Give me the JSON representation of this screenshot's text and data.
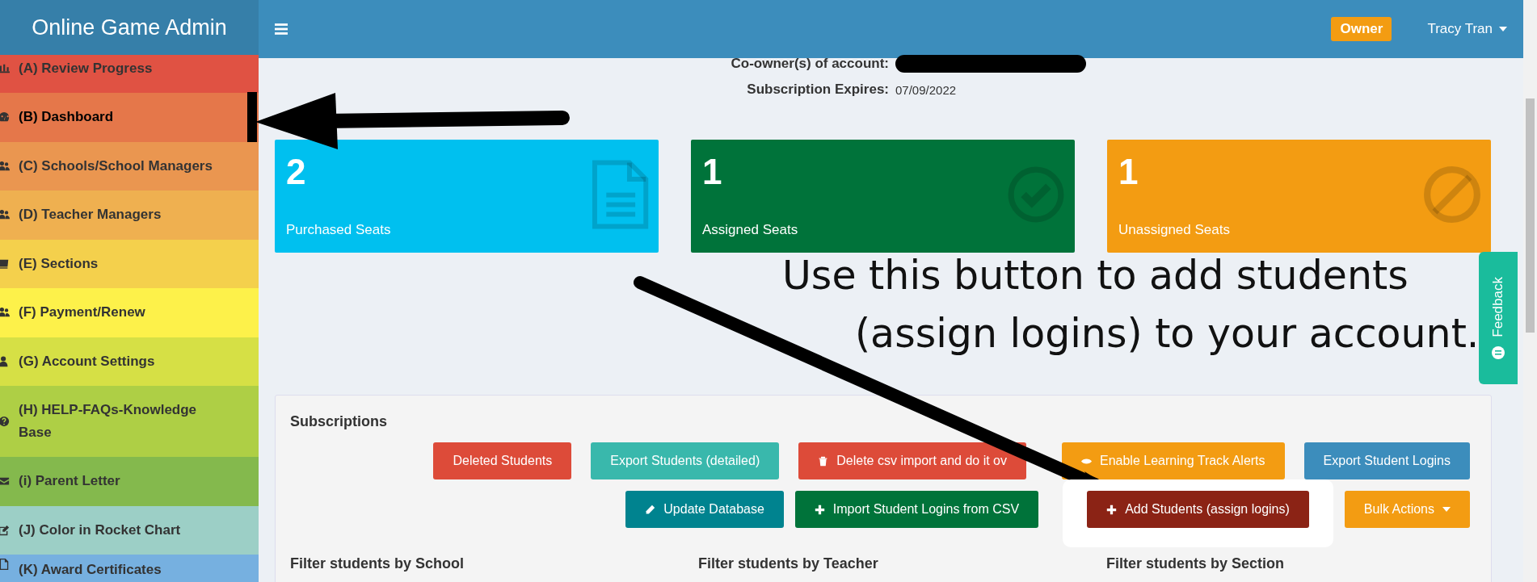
{
  "sidebar": {
    "title": "Online Game Admin",
    "items": [
      {
        "label": "(A) Review Progress",
        "selected": false,
        "color": "#e05243"
      },
      {
        "label": "(B) Dashboard",
        "selected": true,
        "color": "#e5774a"
      },
      {
        "label": "(C) Schools/School Managers",
        "selected": false,
        "color": "#ea9650"
      },
      {
        "label": "(D) Teacher Managers",
        "selected": false,
        "color": "#efb050"
      },
      {
        "label": "(E) Sections",
        "selected": false,
        "color": "#f4d04c"
      },
      {
        "label": "(F) Payment/Renew",
        "selected": false,
        "color": "#fdf14a"
      },
      {
        "label": "(G) Account Settings",
        "selected": false,
        "color": "#d6e045"
      },
      {
        "label": "(H) HELP-FAQs-Knowledge Base",
        "selected": false,
        "color": "#aecf45"
      },
      {
        "label": "(i) Parent Letter",
        "selected": false,
        "color": "#84b94d"
      },
      {
        "label": "(J) Color in Rocket Chart",
        "selected": false,
        "color": "#9ccfc6"
      },
      {
        "label": "(K) Award Certificates",
        "selected": false,
        "color": "#76b0e0"
      }
    ]
  },
  "navbar": {
    "role_badge": "Owner",
    "user": "Tracy Tran"
  },
  "account": [
    {
      "label": "Co-owner(s) of account:",
      "kind": "redacted"
    },
    {
      "label": "Subscription Expires:",
      "value": "07/09/2022",
      "kind": "text"
    }
  ],
  "stats": [
    {
      "count": "2",
      "label": "Purchased Seats",
      "color": "#00c0ef"
    },
    {
      "count": "1",
      "label": "Assigned Seats",
      "color": "#00733a"
    },
    {
      "count": "1",
      "label": "Unassigned Seats",
      "color": "#f39c12"
    }
  ],
  "annotation": {
    "lines": [
      "Use this button to add students",
      "(assign logins) to your account."
    ]
  },
  "feedback_tab": "Feedback",
  "subscriptions": {
    "title": "Subscriptions",
    "button_rows": [
      [
        {
          "label": "Deleted Students",
          "color": "#dd4b39",
          "highlighted": false
        },
        {
          "label": "Export Students (detailed)",
          "color": "#39b8ac",
          "highlighted": false
        },
        {
          "label": "Delete csv import and do it ov",
          "color": "#dd4b39",
          "highlighted": false
        },
        {
          "label": "Enable Learning Track Alerts",
          "color": "#f39c12",
          "highlighted": false
        },
        {
          "label": "Export Student Logins",
          "color": "#3c8dbc",
          "highlighted": false
        }
      ],
      [
        {
          "label": "Update Database",
          "color": "#00838f",
          "highlighted": false
        },
        {
          "label": "Import Student Logins from CSV",
          "color": "#00733a",
          "highlighted": false
        },
        {
          "label": "Add Students (assign logins)",
          "color": "#8b2315",
          "highlighted": true
        },
        {
          "label": "Bulk Actions",
          "color": "#f39c12",
          "highlighted": false,
          "dropdown": true
        }
      ]
    ],
    "filters": [
      "Filter students by School",
      "Filter students by Teacher",
      "Filter students by Section"
    ]
  }
}
